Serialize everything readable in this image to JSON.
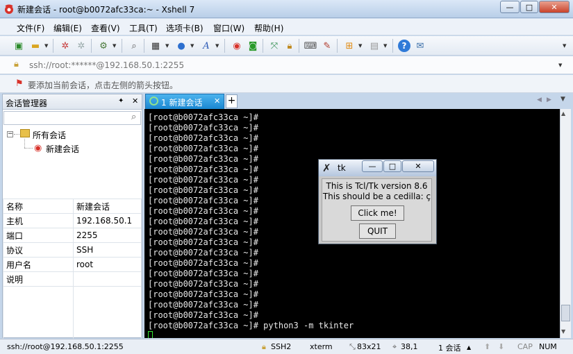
{
  "window": {
    "title": "新建会话 - root@b0072afc33ca:~ - Xshell 7"
  },
  "window_controls": {
    "minimize": "—",
    "maximize": "□",
    "close": "✕"
  },
  "menu": [
    "文件(F)",
    "编辑(E)",
    "查看(V)",
    "工具(T)",
    "选项卡(B)",
    "窗口(W)",
    "帮助(H)"
  ],
  "address": {
    "value": "ssh://root:******@192.168.50.1:2255"
  },
  "hint": {
    "text": "要添加当前会话，点击左侧的箭头按钮。"
  },
  "session_manager": {
    "title": "会话管理器",
    "pin": "✦",
    "close": "✕",
    "tree": {
      "root": "所有会话",
      "child": "新建会话"
    },
    "properties": [
      {
        "key": "名称",
        "value": "新建会话"
      },
      {
        "key": "主机",
        "value": "192.168.50.1"
      },
      {
        "key": "端口",
        "value": "2255"
      },
      {
        "key": "协议",
        "value": "SSH"
      },
      {
        "key": "用户名",
        "value": "root"
      },
      {
        "key": "说明",
        "value": ""
      }
    ]
  },
  "tabs": {
    "active": "1 新建会话",
    "add": "+",
    "close": "✕"
  },
  "terminal": {
    "prompt_line": "[root@b0072afc33ca ~]#",
    "empty_prompt_count": 20,
    "last_command": "[root@b0072afc33ca ~]# python3 -m tkinter"
  },
  "tk": {
    "title": "tk",
    "line1": "This is Tcl/Tk version 8.6",
    "line2": "This should be a cedilla: ç",
    "click_button": "Click me!",
    "quit_button": "QUIT"
  },
  "status": {
    "connection": "ssh://root@192.168.50.1:2255",
    "protocol": "SSH2",
    "term_type": "xterm",
    "size": "83x21",
    "position": "38,1",
    "sessions": "1 会话",
    "cap": "CAP",
    "num": "NUM"
  },
  "colors": {
    "accent": "#1a87d1",
    "terminal_bg": "#000000",
    "cursor": "#33e633"
  }
}
